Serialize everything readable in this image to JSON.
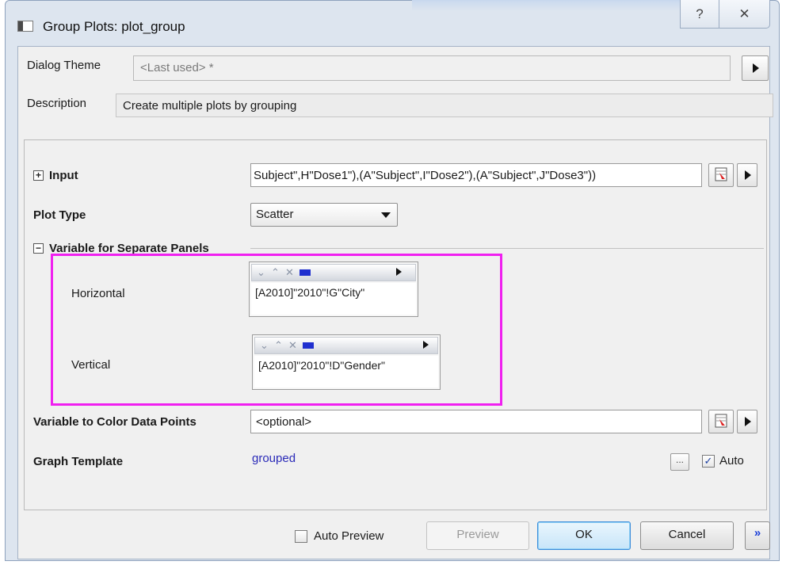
{
  "window": {
    "title": "Group Plots: plot_group",
    "help_glyph": "?",
    "close_glyph": "✕"
  },
  "theme": {
    "label": "Dialog Theme",
    "value": "<Last used> *"
  },
  "description": {
    "label": "Description",
    "value": "Create multiple plots by grouping"
  },
  "input": {
    "expander": "+",
    "label": "Input",
    "value": "Subject\",H\"Dose1\"),(A\"Subject\",I\"Dose2\"),(A\"Subject\",J\"Dose3\"))"
  },
  "plot_type": {
    "label": "Plot Type",
    "value": "Scatter"
  },
  "separate_panels": {
    "expander": "−",
    "label": "Variable for Separate Panels",
    "horizontal": {
      "label": "Horizontal",
      "value": "[A2010]\"2010\"!G\"City\""
    },
    "vertical": {
      "label": "Vertical",
      "value": "[A2010]\"2010\"!D\"Gender\""
    }
  },
  "color_points": {
    "label": "Variable to Color Data Points",
    "placeholder": "<optional>"
  },
  "graph_template": {
    "label": "Graph Template",
    "value": "grouped",
    "browse_label": "...",
    "auto_label": "Auto",
    "auto_checked": true
  },
  "footer": {
    "auto_preview_label": "Auto Preview",
    "preview_label": "Preview",
    "ok_label": "OK",
    "cancel_label": "Cancel",
    "more_glyph": "»"
  },
  "colors": {
    "highlight": "#f020f0",
    "link": "#2a2ab8",
    "accent_blue": "#1f2fcf"
  }
}
